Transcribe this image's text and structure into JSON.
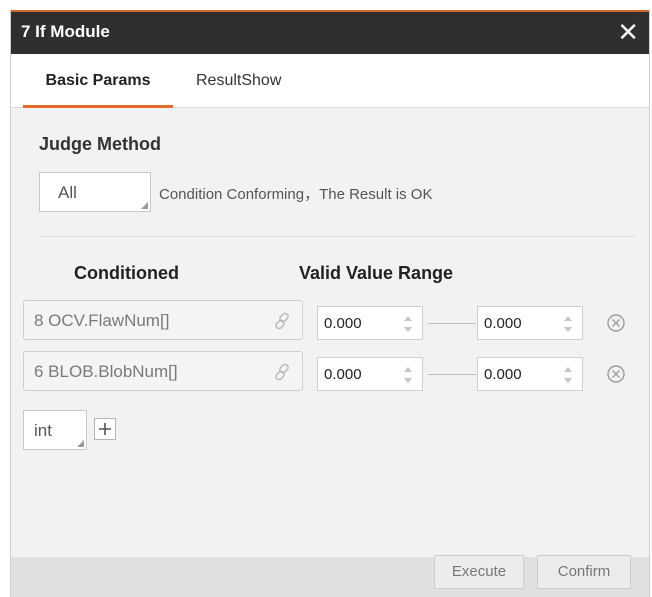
{
  "dialog": {
    "title": "7 If Module",
    "tabs": [
      {
        "label": "Basic Params",
        "active": true
      },
      {
        "label": "ResultShow",
        "active": false
      }
    ]
  },
  "judge": {
    "title": "Judge Method",
    "method": "All",
    "description": "Condition Conforming，The Result is OK"
  },
  "table": {
    "col_conditioned": "Conditioned",
    "col_range": "Valid Value Range",
    "rows": [
      {
        "condition": "8 OCV.FlawNum[]",
        "min": "0.000",
        "max": "0.000"
      },
      {
        "condition": "6 BLOB.BlobNum[]",
        "min": "0.000",
        "max": "0.000"
      }
    ]
  },
  "add_type": "int",
  "buttons": {
    "execute": "Execute",
    "confirm": "Confirm"
  },
  "colors": {
    "title_bar": "#2f2f2f",
    "accent": "#e36b2c",
    "dialog_bg": "#f2f2f2"
  }
}
